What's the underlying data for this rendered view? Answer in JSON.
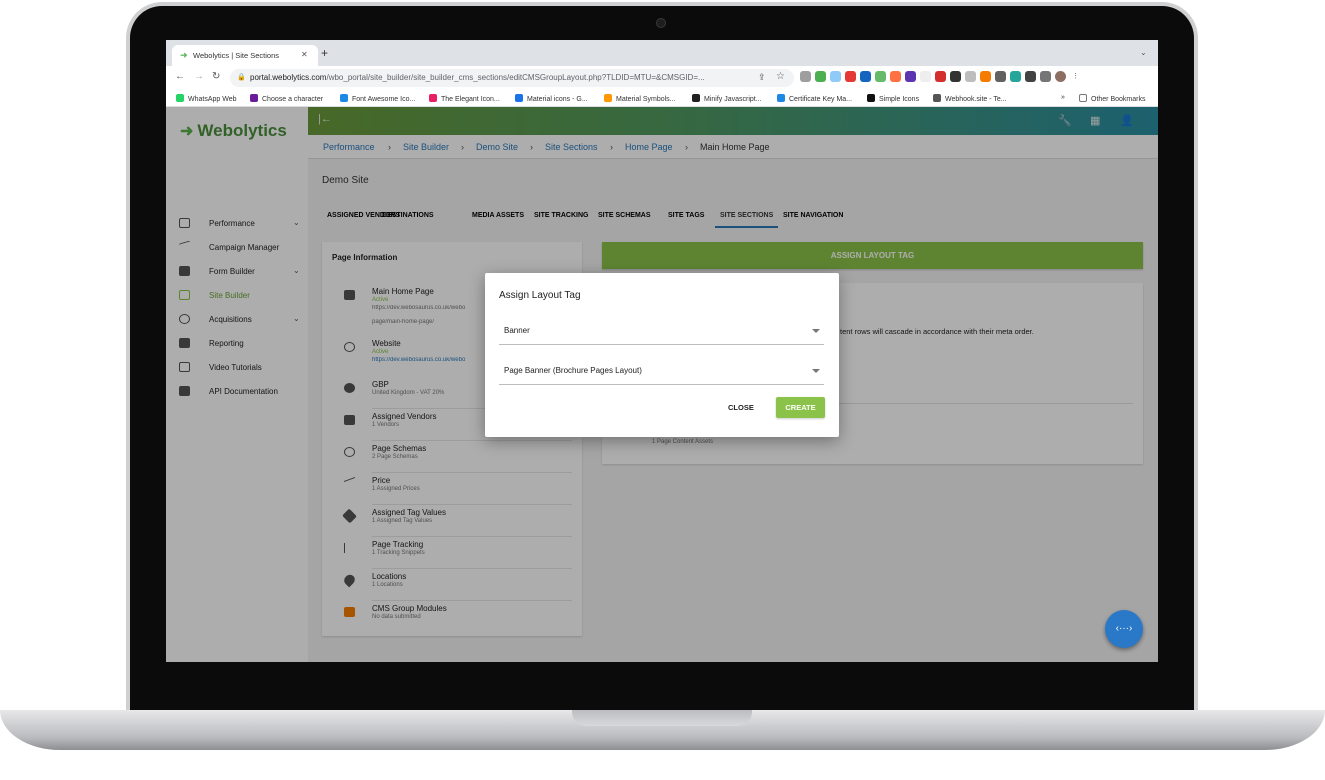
{
  "browser": {
    "tab_title": "Webolytics | Site Sections",
    "new_tab": "+",
    "url_host": "portal.webolytics.com",
    "url_path": "/wbo_portal/site_builder/site_builder_cms_sections/editCMSGroupLayout.php?TLDID=MTU=&CMSGID=...",
    "bookmarks": [
      {
        "label": "WhatsApp Web",
        "color": "#25d366"
      },
      {
        "label": "Choose a character",
        "color": "#6a1b9a"
      },
      {
        "label": "Font Awesome Ico...",
        "color": "#1e88e5"
      },
      {
        "label": "The Elegant Icon...",
        "color": "#e91e63"
      },
      {
        "label": "Material icons - G...",
        "color": "#1a73e8"
      },
      {
        "label": "Material Symbols...",
        "color": "#ff9800"
      },
      {
        "label": "Minify Javascript...",
        "color": "#212121"
      },
      {
        "label": "Certificate Key Ma...",
        "color": "#1e88e5"
      },
      {
        "label": "Simple Icons",
        "color": "#111111"
      },
      {
        "label": "Webhook.site - Te...",
        "color": "#555555"
      }
    ],
    "bookmarks_more": "»",
    "other_bookmarks": "Other Bookmarks"
  },
  "app": {
    "brand": "Webolytics",
    "accent_color": "#8bc34a",
    "link_color": "#2a78b8",
    "sidebar": [
      {
        "label": "Performance",
        "has_chevron": true
      },
      {
        "label": "Campaign Manager",
        "has_chevron": false
      },
      {
        "label": "Form Builder",
        "has_chevron": true
      },
      {
        "label": "Site Builder",
        "has_chevron": false,
        "active": true
      },
      {
        "label": "Acquisitions",
        "has_chevron": true
      },
      {
        "label": "Reporting",
        "has_chevron": false
      },
      {
        "label": "Video Tutorials",
        "has_chevron": false
      },
      {
        "label": "API Documentation",
        "has_chevron": false
      }
    ],
    "breadcrumb": [
      "Performance",
      "Site Builder",
      "Demo Site",
      "Site Sections",
      "Home Page",
      "Main Home Page"
    ],
    "page_title": "Demo Site",
    "tabs": [
      "ASSIGNED VENDORS",
      "DESTINATIONS",
      "MEDIA ASSETS",
      "SITE TRACKING",
      "SITE SCHEMAS",
      "SITE TAGS",
      "SITE SECTIONS",
      "SITE NAVIGATION"
    ],
    "active_tab": "SITE SECTIONS",
    "page_info": {
      "title": "Page Information",
      "items": [
        {
          "title": "Main Home Page",
          "sub": "Active",
          "line2": "https://dev.webosaurus.co.uk/webo",
          "line3": "page/main-home-page/"
        },
        {
          "title": "Website",
          "sub": "Active",
          "line2": "https://dev.webosaurus.co.uk/webo"
        },
        {
          "title": "GBP",
          "sub": "United Kingdom - VAT 20%"
        },
        {
          "title": "Assigned Vendors",
          "sub": "1 Vendors"
        },
        {
          "title": "Page Schemas",
          "sub": "2 Page Schemas"
        },
        {
          "title": "Price",
          "sub": "1 Assigned Prices"
        },
        {
          "title": "Assigned Tag Values",
          "sub": "1 Assigned Tag Values"
        },
        {
          "title": "Page Tracking",
          "sub": "1 Tracking Snippets"
        },
        {
          "title": "Locations",
          "sub": "1 Locations"
        },
        {
          "title": "CMS Group Modules",
          "sub": "No data submitted"
        }
      ]
    },
    "assign_button": "ASSIGN LAYOUT TAG",
    "right_desc": "tent rows will cascade in accordance with their meta order.",
    "right_assets": "1 Page Content Assets",
    "fab_label": "‹···›"
  },
  "modal": {
    "title": "Assign Layout Tag",
    "field1_value": "Banner",
    "field2_value": "Page Banner (Brochure Pages Layout)",
    "close_label": "CLOSE",
    "create_label": "CREATE"
  }
}
